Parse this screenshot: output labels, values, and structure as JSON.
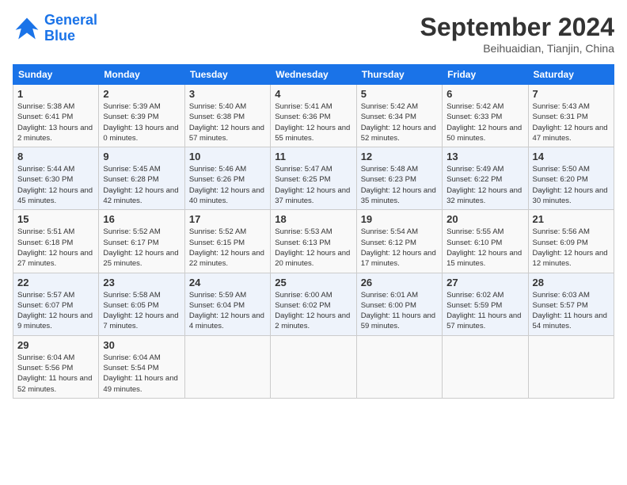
{
  "logo": {
    "text_general": "General",
    "text_blue": "Blue"
  },
  "title": {
    "month_year": "September 2024",
    "location": "Beihuaidian, Tianjin, China"
  },
  "weekdays": [
    "Sunday",
    "Monday",
    "Tuesday",
    "Wednesday",
    "Thursday",
    "Friday",
    "Saturday"
  ],
  "weeks": [
    [
      {
        "day": "1",
        "sunrise": "5:38 AM",
        "sunset": "6:41 PM",
        "daylight": "13 hours and 2 minutes."
      },
      {
        "day": "2",
        "sunrise": "5:39 AM",
        "sunset": "6:39 PM",
        "daylight": "13 hours and 0 minutes."
      },
      {
        "day": "3",
        "sunrise": "5:40 AM",
        "sunset": "6:38 PM",
        "daylight": "12 hours and 57 minutes."
      },
      {
        "day": "4",
        "sunrise": "5:41 AM",
        "sunset": "6:36 PM",
        "daylight": "12 hours and 55 minutes."
      },
      {
        "day": "5",
        "sunrise": "5:42 AM",
        "sunset": "6:34 PM",
        "daylight": "12 hours and 52 minutes."
      },
      {
        "day": "6",
        "sunrise": "5:42 AM",
        "sunset": "6:33 PM",
        "daylight": "12 hours and 50 minutes."
      },
      {
        "day": "7",
        "sunrise": "5:43 AM",
        "sunset": "6:31 PM",
        "daylight": "12 hours and 47 minutes."
      }
    ],
    [
      {
        "day": "8",
        "sunrise": "5:44 AM",
        "sunset": "6:30 PM",
        "daylight": "12 hours and 45 minutes."
      },
      {
        "day": "9",
        "sunrise": "5:45 AM",
        "sunset": "6:28 PM",
        "daylight": "12 hours and 42 minutes."
      },
      {
        "day": "10",
        "sunrise": "5:46 AM",
        "sunset": "6:26 PM",
        "daylight": "12 hours and 40 minutes."
      },
      {
        "day": "11",
        "sunrise": "5:47 AM",
        "sunset": "6:25 PM",
        "daylight": "12 hours and 37 minutes."
      },
      {
        "day": "12",
        "sunrise": "5:48 AM",
        "sunset": "6:23 PM",
        "daylight": "12 hours and 35 minutes."
      },
      {
        "day": "13",
        "sunrise": "5:49 AM",
        "sunset": "6:22 PM",
        "daylight": "12 hours and 32 minutes."
      },
      {
        "day": "14",
        "sunrise": "5:50 AM",
        "sunset": "6:20 PM",
        "daylight": "12 hours and 30 minutes."
      }
    ],
    [
      {
        "day": "15",
        "sunrise": "5:51 AM",
        "sunset": "6:18 PM",
        "daylight": "12 hours and 27 minutes."
      },
      {
        "day": "16",
        "sunrise": "5:52 AM",
        "sunset": "6:17 PM",
        "daylight": "12 hours and 25 minutes."
      },
      {
        "day": "17",
        "sunrise": "5:52 AM",
        "sunset": "6:15 PM",
        "daylight": "12 hours and 22 minutes."
      },
      {
        "day": "18",
        "sunrise": "5:53 AM",
        "sunset": "6:13 PM",
        "daylight": "12 hours and 20 minutes."
      },
      {
        "day": "19",
        "sunrise": "5:54 AM",
        "sunset": "6:12 PM",
        "daylight": "12 hours and 17 minutes."
      },
      {
        "day": "20",
        "sunrise": "5:55 AM",
        "sunset": "6:10 PM",
        "daylight": "12 hours and 15 minutes."
      },
      {
        "day": "21",
        "sunrise": "5:56 AM",
        "sunset": "6:09 PM",
        "daylight": "12 hours and 12 minutes."
      }
    ],
    [
      {
        "day": "22",
        "sunrise": "5:57 AM",
        "sunset": "6:07 PM",
        "daylight": "12 hours and 9 minutes."
      },
      {
        "day": "23",
        "sunrise": "5:58 AM",
        "sunset": "6:05 PM",
        "daylight": "12 hours and 7 minutes."
      },
      {
        "day": "24",
        "sunrise": "5:59 AM",
        "sunset": "6:04 PM",
        "daylight": "12 hours and 4 minutes."
      },
      {
        "day": "25",
        "sunrise": "6:00 AM",
        "sunset": "6:02 PM",
        "daylight": "12 hours and 2 minutes."
      },
      {
        "day": "26",
        "sunrise": "6:01 AM",
        "sunset": "6:00 PM",
        "daylight": "11 hours and 59 minutes."
      },
      {
        "day": "27",
        "sunrise": "6:02 AM",
        "sunset": "5:59 PM",
        "daylight": "11 hours and 57 minutes."
      },
      {
        "day": "28",
        "sunrise": "6:03 AM",
        "sunset": "5:57 PM",
        "daylight": "11 hours and 54 minutes."
      }
    ],
    [
      {
        "day": "29",
        "sunrise": "6:04 AM",
        "sunset": "5:56 PM",
        "daylight": "11 hours and 52 minutes."
      },
      {
        "day": "30",
        "sunrise": "6:04 AM",
        "sunset": "5:54 PM",
        "daylight": "11 hours and 49 minutes."
      },
      null,
      null,
      null,
      null,
      null
    ]
  ]
}
